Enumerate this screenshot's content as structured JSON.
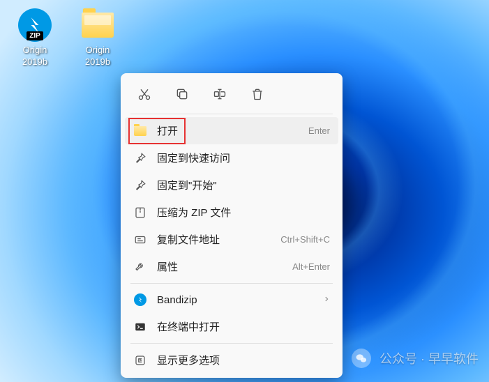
{
  "desktop": {
    "icons": [
      {
        "name": "zip-shortcut",
        "label": "Origin\n2019b",
        "badge": "ZIP"
      },
      {
        "name": "folder-shortcut",
        "label": "Origin\n2019b"
      }
    ]
  },
  "context_menu": {
    "action_bar": [
      {
        "name": "cut-icon"
      },
      {
        "name": "copy-icon"
      },
      {
        "name": "rename-icon"
      },
      {
        "name": "delete-icon"
      }
    ],
    "groups": [
      [
        {
          "name": "open",
          "icon": "folder-icon",
          "label": "打开",
          "shortcut": "Enter",
          "highlighted": true
        },
        {
          "name": "pin-quick-access",
          "icon": "pin-icon",
          "label": "固定到快速访问",
          "shortcut": ""
        },
        {
          "name": "pin-start",
          "icon": "pin-icon",
          "label": "固定到\"开始\"",
          "shortcut": ""
        },
        {
          "name": "compress-zip",
          "icon": "zip-icon",
          "label": "压缩为 ZIP 文件",
          "shortcut": ""
        },
        {
          "name": "copy-path",
          "icon": "path-icon",
          "label": "复制文件地址",
          "shortcut": "Ctrl+Shift+C"
        },
        {
          "name": "properties",
          "icon": "wrench-icon",
          "label": "属性",
          "shortcut": "Alt+Enter"
        }
      ],
      [
        {
          "name": "bandizip",
          "icon": "bandizip-icon",
          "label": "Bandizip",
          "submenu": true
        },
        {
          "name": "open-terminal",
          "icon": "terminal-icon",
          "label": "在终端中打开",
          "shortcut": ""
        }
      ],
      [
        {
          "name": "more-options",
          "icon": "more-icon",
          "label": "显示更多选项",
          "shortcut": ""
        }
      ]
    ]
  },
  "watermark": {
    "text": "公众号 · 早早软件"
  }
}
